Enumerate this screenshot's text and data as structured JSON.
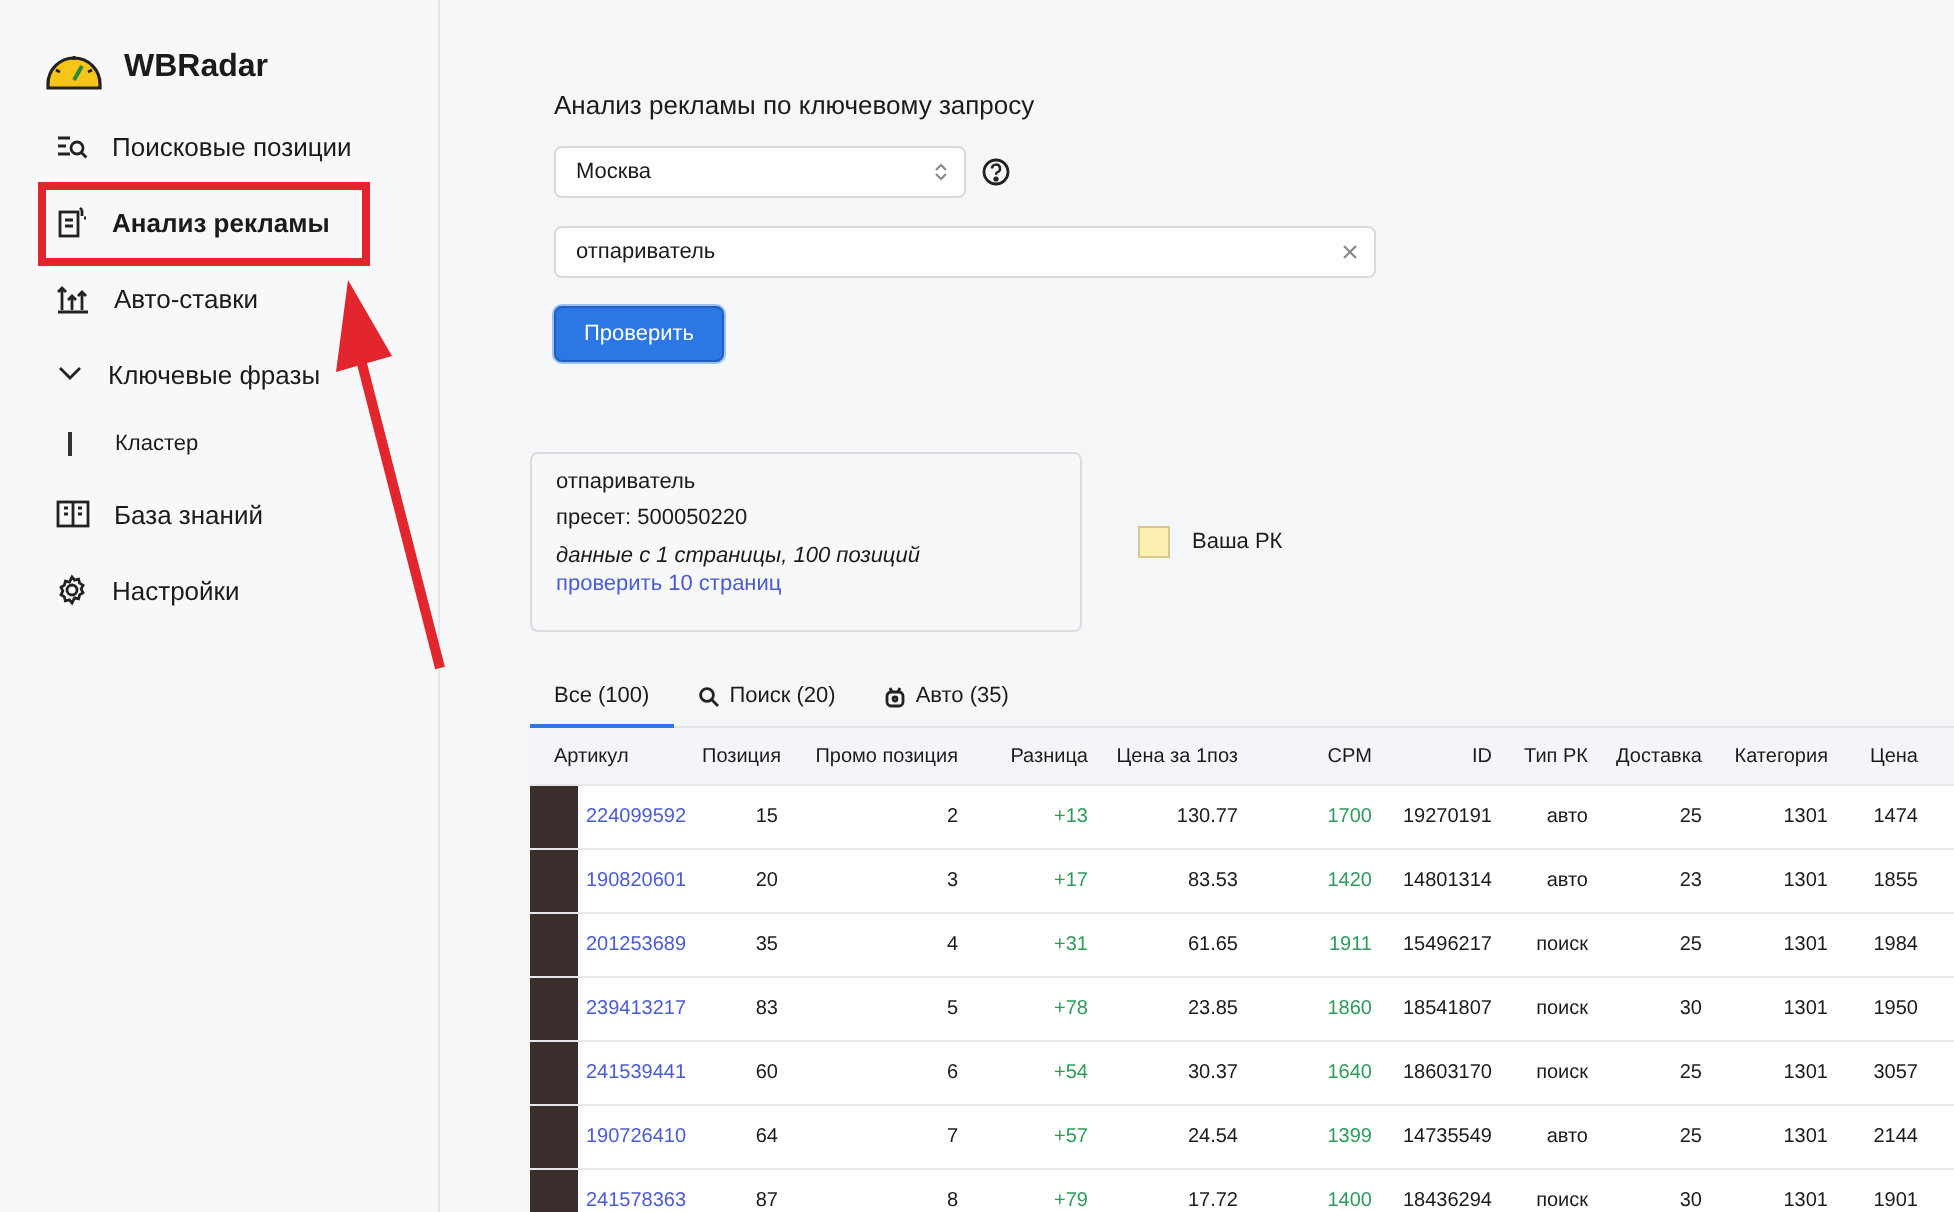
{
  "app": {
    "name": "WBRadar"
  },
  "sidebar": {
    "items": [
      {
        "kind": "link",
        "label": "Поисковые позиции",
        "selected": false
      },
      {
        "kind": "link",
        "label": "Анализ рекламы",
        "selected": true
      },
      {
        "kind": "link",
        "label": "Авто-ставки",
        "selected": false
      },
      {
        "kind": "group",
        "label": "Ключевые фразы",
        "expanded": true,
        "selected": false,
        "children": [
          {
            "label": "Кластер",
            "selected": false
          }
        ]
      },
      {
        "kind": "link",
        "label": "База знаний",
        "selected": false
      },
      {
        "kind": "link",
        "label": "Настройки",
        "selected": false
      }
    ]
  },
  "annotation": {
    "kind": "highlight-arrow"
  },
  "form": {
    "title": "Анализ рекламы по ключевому запросу",
    "region": "Москва",
    "query": "отпариватель",
    "submit": "Проверить"
  },
  "summary": {
    "query": "отпариватель",
    "preset": "пресет: 500050220",
    "note": "данные с 1 страницы, 100 позиций",
    "link": "проверить 10 страниц"
  },
  "legend": [
    {
      "label": "Ваша РК",
      "color": "#fbf0b0"
    }
  ],
  "tabs": [
    {
      "label": "Все (100)",
      "selected": true
    },
    {
      "label": "Поиск (20)",
      "selected": false
    },
    {
      "label": "Авто (35)",
      "selected": false
    }
  ],
  "table": {
    "columns": [
      "Артикул",
      "Позиция",
      "Промо позиция",
      "Разница",
      "Цена за 1поз",
      "CPM",
      "ID",
      "Тип РК",
      "Доставка",
      "Категория",
      "Цена"
    ],
    "rows": [
      [
        "224099592",
        "15",
        "2",
        "+13",
        "130.77",
        "1700",
        "19270191",
        "авто",
        "25",
        "1301",
        "1474"
      ],
      [
        "190820601",
        "20",
        "3",
        "+17",
        "83.53",
        "1420",
        "14801314",
        "авто",
        "23",
        "1301",
        "1855"
      ],
      [
        "201253689",
        "35",
        "4",
        "+31",
        "61.65",
        "1911",
        "15496217",
        "поиск",
        "25",
        "1301",
        "1984"
      ],
      [
        "239413217",
        "83",
        "5",
        "+78",
        "23.85",
        "1860",
        "18541807",
        "поиск",
        "30",
        "1301",
        "1950"
      ],
      [
        "241539441",
        "60",
        "6",
        "+54",
        "30.37",
        "1640",
        "18603170",
        "поиск",
        "25",
        "1301",
        "3057"
      ],
      [
        "190726410",
        "64",
        "7",
        "+57",
        "24.54",
        "1399",
        "14735549",
        "авто",
        "25",
        "1301",
        "2144"
      ],
      [
        "241578363",
        "87",
        "8",
        "+79",
        "17.72",
        "1400",
        "18436294",
        "поиск",
        "30",
        "1301",
        "1901"
      ]
    ]
  }
}
